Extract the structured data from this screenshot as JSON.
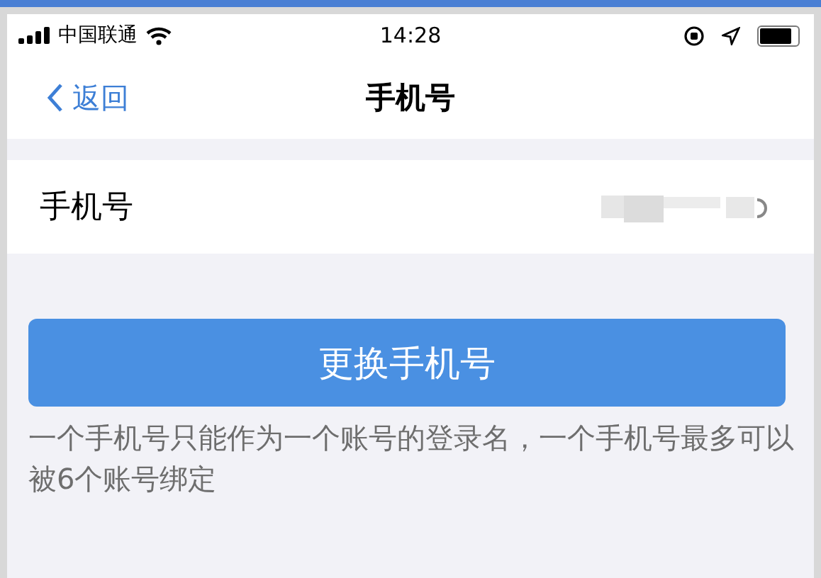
{
  "status_bar": {
    "carrier": "中国联通",
    "time": "14:28"
  },
  "nav": {
    "back": "返回",
    "title": "手机号"
  },
  "phone_row": {
    "label": "手机号"
  },
  "change_button": "更换手机号",
  "note": "一个手机号只能作为一个账号的登录名，一个手机号最多可以被6个账号绑定"
}
